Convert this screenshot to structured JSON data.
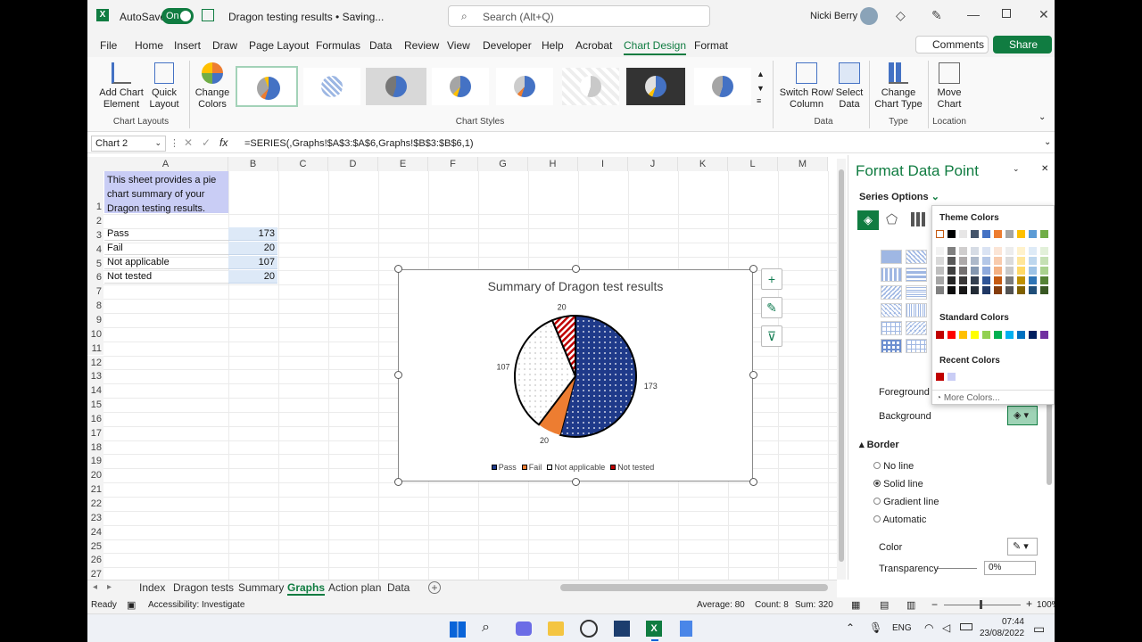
{
  "titlebar": {
    "autosave_label": "AutoSave",
    "autosave_state": "On",
    "doc_title": "Dragon testing results • Saving...",
    "search_placeholder": "Search (Alt+Q)",
    "user": "Nicki Berry"
  },
  "menu": [
    "File",
    "Home",
    "Insert",
    "Draw",
    "Page Layout",
    "Formulas",
    "Data",
    "Review",
    "View",
    "Developer",
    "Help",
    "Acrobat",
    "Chart Design",
    "Format"
  ],
  "comments": "Comments",
  "share": "Share",
  "ribbon": {
    "add_chart_element": [
      "Add Chart",
      "Element"
    ],
    "quick_layout": [
      "Quick",
      "Layout"
    ],
    "change_colors": [
      "Change",
      "Colors"
    ],
    "group_chart_layouts": "Chart Layouts",
    "group_chart_styles": "Chart Styles",
    "switch_row": [
      "Switch Row/",
      "Column"
    ],
    "select_data": [
      "Select",
      "Data"
    ],
    "group_data": "Data",
    "change_chart_type": [
      "Change",
      "Chart Type"
    ],
    "group_type": "Type",
    "move_chart": [
      "Move",
      "Chart"
    ],
    "group_location": "Location"
  },
  "formula": {
    "namebox": "Chart 2",
    "fx": "fx",
    "value": "=SERIES(,Graphs!$A$3:$A$6,Graphs!$B$3:$B$6,1)"
  },
  "columns": [
    "A",
    "B",
    "C",
    "D",
    "E",
    "F",
    "G",
    "H",
    "I",
    "J",
    "K",
    "L",
    "M"
  ],
  "rows": [
    "1",
    "2",
    "3",
    "4",
    "5",
    "6",
    "7",
    "8",
    "9",
    "10",
    "11",
    "12",
    "13",
    "14",
    "15",
    "16",
    "17",
    "18",
    "19",
    "20",
    "21",
    "22",
    "23",
    "24",
    "25",
    "26",
    "27"
  ],
  "sheet": {
    "note": [
      "This sheet provides a pie",
      "chart summary of your",
      "Dragon testing results."
    ],
    "table": [
      {
        "label": "Pass",
        "value": "173"
      },
      {
        "label": "Fail",
        "value": "20"
      },
      {
        "label": "Not applicable",
        "value": "107"
      },
      {
        "label": "Not tested",
        "value": "20"
      }
    ]
  },
  "chart_data": {
    "type": "pie",
    "title": "Summary of Dragon test results",
    "categories": [
      "Pass",
      "Fail",
      "Not applicable",
      "Not tested"
    ],
    "values": [
      173,
      20,
      107,
      20
    ],
    "colors": [
      "#1f3a8a",
      "#ed7d31",
      "#ffffff",
      "#c00000"
    ],
    "data_labels": [
      "173",
      "20",
      "107",
      "20"
    ],
    "legend": "bottom"
  },
  "tabs": [
    "Index",
    "Dragon tests",
    "Summary",
    "Graphs",
    "Action plan",
    "Data"
  ],
  "active_tab": "Graphs",
  "status": {
    "ready": "Ready",
    "accessibility": "Accessibility: Investigate",
    "average": "Average: 80",
    "count": "Count: 8",
    "sum": "Sum: 320",
    "zoom": "100%"
  },
  "taskbar": {
    "lang": "ENG",
    "time": "07:44",
    "date": "23/08/2022"
  },
  "pane": {
    "title": "Format Data Point",
    "series_options": "Series Options",
    "foreground": "Foreground",
    "background": "Background",
    "border": "Border",
    "no_line": "No line",
    "solid_line": "Solid line",
    "gradient_line": "Gradient line",
    "automatic": "Automatic",
    "color": "Color",
    "transparency": "Transparency",
    "transparency_value": "0%"
  },
  "picker": {
    "theme_colors": "Theme Colors",
    "standard_colors": "Standard Colors",
    "recent_colors": "Recent Colors",
    "more_colors": "More Colors...",
    "theme_row": [
      "#ffffff",
      "#000000",
      "#e7e6e6",
      "#44546a",
      "#4472c4",
      "#ed7d31",
      "#a5a5a5",
      "#ffc000",
      "#5b9bd5",
      "#70ad47"
    ],
    "standard_row": [
      "#c00000",
      "#ff0000",
      "#ffc000",
      "#ffff00",
      "#92d050",
      "#00b050",
      "#00b0f0",
      "#0070c0",
      "#002060",
      "#7030a0"
    ],
    "recent_row": [
      "#c00000",
      "#c9cdf5"
    ]
  }
}
